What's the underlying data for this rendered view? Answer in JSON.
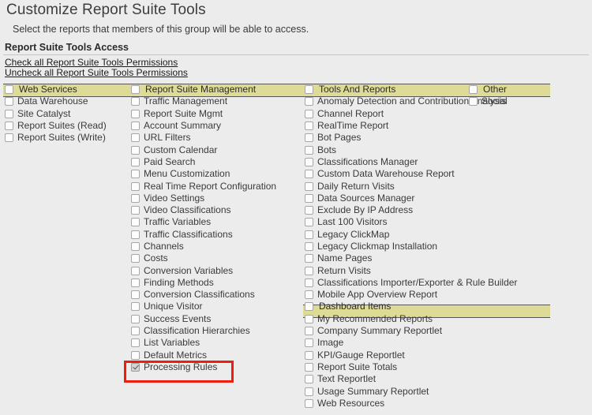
{
  "page": {
    "title": "Customize Report Suite Tools",
    "intro": "Select the reports that members of this group will be able to access.",
    "section_title": "Report Suite Tools Access",
    "check_all_link": "Check all Report Suite Tools Permissions",
    "uncheck_all_link": "Uncheck all Report Suite Tools Permissions"
  },
  "colors": {
    "group_header_bg": "#dedb96",
    "page_bg": "#ececec",
    "highlight_border": "#f01d0e",
    "text": "#3a3a3a"
  },
  "columns": [
    {
      "id": "web-services",
      "header": {
        "label": "Web Services",
        "checked": false
      },
      "items": [
        {
          "label": "Data Warehouse",
          "checked": false
        },
        {
          "label": "Site Catalyst",
          "checked": false
        },
        {
          "label": "Report Suites (Read)",
          "checked": false
        },
        {
          "label": "Report Suites (Write)",
          "checked": false
        }
      ]
    },
    {
      "id": "report-suite-management",
      "header": {
        "label": "Report Suite Management",
        "checked": false
      },
      "items": [
        {
          "label": "Traffic Management",
          "checked": false
        },
        {
          "label": "Report Suite Mgmt",
          "checked": false
        },
        {
          "label": "Account Summary",
          "checked": false
        },
        {
          "label": "URL Filters",
          "checked": false
        },
        {
          "label": "Custom Calendar",
          "checked": false
        },
        {
          "label": "Paid Search",
          "checked": false
        },
        {
          "label": "Menu Customization",
          "checked": false
        },
        {
          "label": "Real Time Report Configuration",
          "checked": false
        },
        {
          "label": "Video Settings",
          "checked": false
        },
        {
          "label": "Video Classifications",
          "checked": false
        },
        {
          "label": "Traffic Variables",
          "checked": false
        },
        {
          "label": "Traffic Classifications",
          "checked": false
        },
        {
          "label": "Channels",
          "checked": false
        },
        {
          "label": "Costs",
          "checked": false
        },
        {
          "label": "Conversion Variables",
          "checked": false
        },
        {
          "label": "Finding Methods",
          "checked": false
        },
        {
          "label": "Conversion Classifications",
          "checked": false
        },
        {
          "label": "Unique Visitor",
          "checked": false
        },
        {
          "label": "Success Events",
          "checked": false
        },
        {
          "label": "Classification Hierarchies",
          "checked": false
        },
        {
          "label": "List Variables",
          "checked": false
        },
        {
          "label": "Default Metrics",
          "checked": false
        },
        {
          "label": "Processing Rules",
          "checked": true
        }
      ]
    },
    {
      "id": "tools-and-reports",
      "header": {
        "label": "Tools And Reports",
        "checked": false
      },
      "items": [
        {
          "label": "Anomaly Detection and Contribution Analysis",
          "checked": false
        },
        {
          "label": "Channel Report",
          "checked": false
        },
        {
          "label": "RealTime Report",
          "checked": false
        },
        {
          "label": "Bot Pages",
          "checked": false
        },
        {
          "label": "Bots",
          "checked": false
        },
        {
          "label": "Classifications Manager",
          "checked": false
        },
        {
          "label": "Custom Data Warehouse Report",
          "checked": false
        },
        {
          "label": "Daily Return Visits",
          "checked": false
        },
        {
          "label": "Data Sources Manager",
          "checked": false
        },
        {
          "label": "Exclude By IP Address",
          "checked": false
        },
        {
          "label": "Last 100 Visitors",
          "checked": false
        },
        {
          "label": "Legacy ClickMap",
          "checked": false
        },
        {
          "label": "Legacy Clickmap Installation",
          "checked": false
        },
        {
          "label": "Name Pages",
          "checked": false
        },
        {
          "label": "Return Visits",
          "checked": false
        },
        {
          "label": "Classifications Importer/Exporter & Rule Builder",
          "checked": false
        },
        {
          "label": "Mobile App Overview Report",
          "checked": false
        }
      ],
      "subgroup": {
        "header": {
          "label": "Dashboard Items",
          "checked": false
        },
        "items": [
          {
            "label": "My Recommended Reports",
            "checked": false
          },
          {
            "label": "Company Summary Reportlet",
            "checked": false
          },
          {
            "label": "Image",
            "checked": false
          },
          {
            "label": "KPI/Gauge Reportlet",
            "checked": false
          },
          {
            "label": "Report Suite Totals",
            "checked": false
          },
          {
            "label": "Text Reportlet",
            "checked": false
          },
          {
            "label": "Usage Summary Reportlet",
            "checked": false
          },
          {
            "label": "Web Resources",
            "checked": false
          }
        ]
      }
    },
    {
      "id": "other",
      "header": {
        "label": "Other",
        "checked": false
      },
      "items": [
        {
          "label": "Social",
          "checked": false
        }
      ]
    }
  ],
  "annotation": {
    "highlighted_item": "Processing Rules"
  }
}
